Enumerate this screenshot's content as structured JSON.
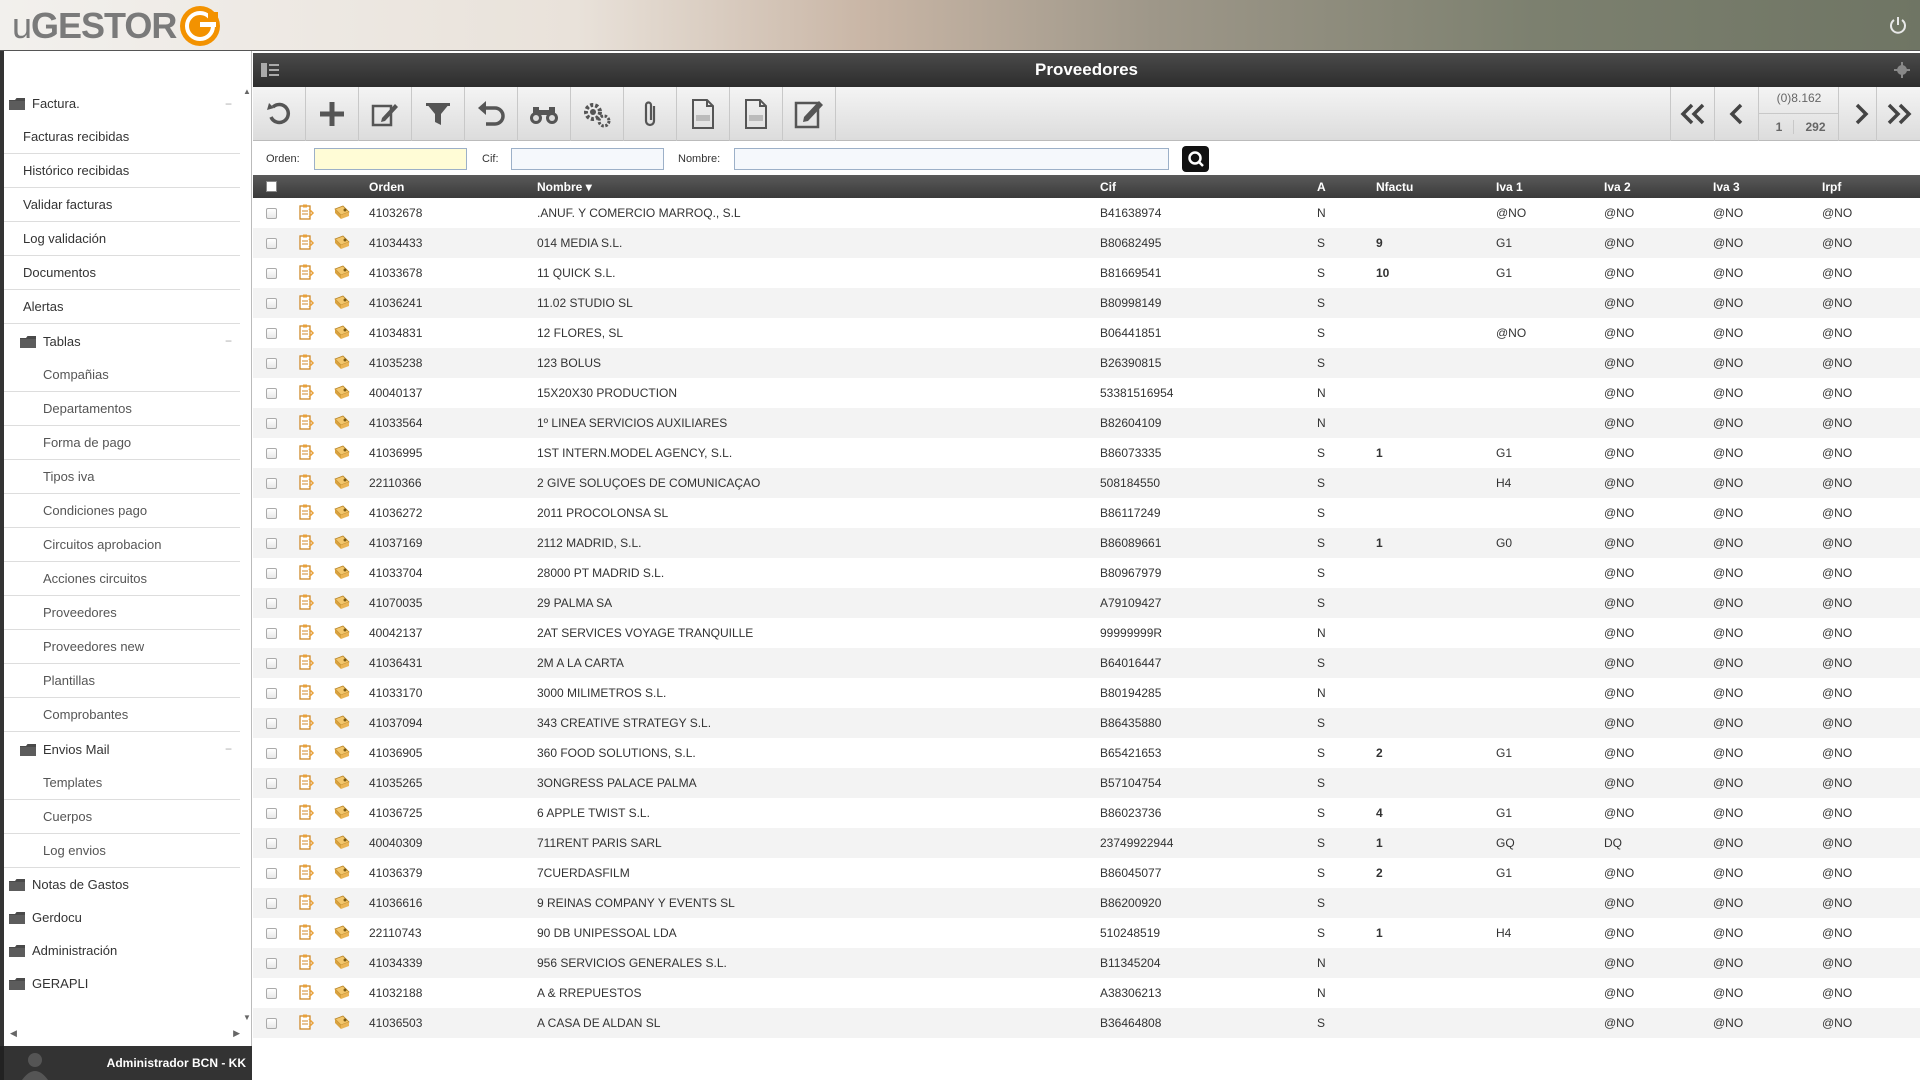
{
  "app": {
    "logo_prefix": "u",
    "logo_main": "GESTOR",
    "user_name": "Administrador BCN - KK"
  },
  "colors": {
    "accent": "#f39200",
    "header_dark": "#333333"
  },
  "sidebar": {
    "items": [
      {
        "label": "Factura.",
        "level": 0,
        "folder": true,
        "collapsible": true
      },
      {
        "label": "Facturas recibidas",
        "level": 1
      },
      {
        "label": "Histórico recibidas",
        "level": 1
      },
      {
        "label": "Validar facturas",
        "level": 1
      },
      {
        "label": "Log validación",
        "level": 1
      },
      {
        "label": "Documentos",
        "level": 1
      },
      {
        "label": "Alertas",
        "level": 1
      },
      {
        "label": "Tablas",
        "level": 1,
        "folder": true,
        "collapsible": true
      },
      {
        "label": "Compañias",
        "level": 2
      },
      {
        "label": "Departamentos",
        "level": 2
      },
      {
        "label": "Forma de pago",
        "level": 2
      },
      {
        "label": "Tipos iva",
        "level": 2
      },
      {
        "label": "Condiciones pago",
        "level": 2
      },
      {
        "label": "Circuitos aprobacion",
        "level": 2
      },
      {
        "label": "Acciones circuitos",
        "level": 2
      },
      {
        "label": "Proveedores",
        "level": 2
      },
      {
        "label": "Proveedores new",
        "level": 2
      },
      {
        "label": "Plantillas",
        "level": 2
      },
      {
        "label": "Comprobantes",
        "level": 2
      },
      {
        "label": "Envios Mail",
        "level": 1,
        "folder": true,
        "collapsible": true
      },
      {
        "label": "Templates",
        "level": 2
      },
      {
        "label": "Cuerpos",
        "level": 2
      },
      {
        "label": "Log envios",
        "level": 2
      },
      {
        "label": "Notas de Gastos",
        "level": 0,
        "folder": true
      },
      {
        "label": "Gerdocu",
        "level": 0,
        "folder": true
      },
      {
        "label": "Administración",
        "level": 0,
        "folder": true
      },
      {
        "label": "GERAPLI",
        "level": 0,
        "folder": true
      }
    ]
  },
  "page": {
    "title": "Proveedores"
  },
  "toolbar": {
    "buttons": [
      "refresh-icon",
      "add-icon",
      "edit-icon",
      "filter-icon",
      "undo-icon",
      "view-icon",
      "settings-icon",
      "attach-icon",
      "pdf-icon",
      "xls-icon",
      "notes-icon"
    ]
  },
  "pager": {
    "total": "(0)8.162",
    "current": "1",
    "pages": "292"
  },
  "filters": {
    "orden_label": "Orden:",
    "orden_value": "",
    "cif_label": "Cif:",
    "cif_value": "",
    "nombre_label": "Nombre:",
    "nombre_value": ""
  },
  "grid": {
    "columns": {
      "orden": "Orden",
      "nombre": "Nombre",
      "cif": "Cif",
      "a": "A",
      "nfactu": "Nfactu",
      "iva1": "Iva 1",
      "iva2": "Iva 2",
      "iva3": "Iva 3",
      "irpf": "Irpf"
    },
    "sort_indicator": "▾",
    "rows": [
      {
        "orden": "41032678",
        "nombre": ".ANUF. Y COMERCIO MARROQ., S.L",
        "cif": "B41638974",
        "a": "N",
        "nfactu": "",
        "iva1": "@NO",
        "iva2": "@NO",
        "iva3": "@NO",
        "irpf": "@NO"
      },
      {
        "orden": "41034433",
        "nombre": "014 MEDIA S.L.",
        "cif": "B80682495",
        "a": "S",
        "nfactu": "9",
        "iva1": "G1",
        "iva2": "@NO",
        "iva3": "@NO",
        "irpf": "@NO"
      },
      {
        "orden": "41033678",
        "nombre": "11 QUICK S.L.",
        "cif": "B81669541",
        "a": "S",
        "nfactu": "10",
        "iva1": "G1",
        "iva2": "@NO",
        "iva3": "@NO",
        "irpf": "@NO"
      },
      {
        "orden": "41036241",
        "nombre": "11.02 STUDIO SL",
        "cif": "B80998149",
        "a": "S",
        "nfactu": "",
        "iva1": "",
        "iva2": "@NO",
        "iva3": "@NO",
        "irpf": "@NO"
      },
      {
        "orden": "41034831",
        "nombre": "12 FLORES, SL",
        "cif": "B06441851",
        "a": "S",
        "nfactu": "",
        "iva1": "@NO",
        "iva2": "@NO",
        "iva3": "@NO",
        "irpf": "@NO"
      },
      {
        "orden": "41035238",
        "nombre": "123 BOLUS",
        "cif": "B26390815",
        "a": "S",
        "nfactu": "",
        "iva1": "",
        "iva2": "@NO",
        "iva3": "@NO",
        "irpf": "@NO"
      },
      {
        "orden": "40040137",
        "nombre": "15X20X30 PRODUCTION",
        "cif": "53381516954",
        "a": "N",
        "nfactu": "",
        "iva1": "",
        "iva2": "@NO",
        "iva3": "@NO",
        "irpf": "@NO"
      },
      {
        "orden": "41033564",
        "nombre": "1º LINEA SERVICIOS AUXILIARES",
        "cif": "B82604109",
        "a": "N",
        "nfactu": "",
        "iva1": "",
        "iva2": "@NO",
        "iva3": "@NO",
        "irpf": "@NO"
      },
      {
        "orden": "41036995",
        "nombre": "1ST INTERN.MODEL AGENCY, S.L.",
        "cif": "B86073335",
        "a": "S",
        "nfactu": "1",
        "iva1": "G1",
        "iva2": "@NO",
        "iva3": "@NO",
        "irpf": "@NO"
      },
      {
        "orden": "22110366",
        "nombre": "2 GIVE SOLUÇOES DE COMUNICAÇAO",
        "cif": "508184550",
        "a": "S",
        "nfactu": "",
        "iva1": "H4",
        "iva2": "@NO",
        "iva3": "@NO",
        "irpf": "@NO"
      },
      {
        "orden": "41036272",
        "nombre": "2011 PROCOLONSA SL",
        "cif": "B86117249",
        "a": "S",
        "nfactu": "",
        "iva1": "",
        "iva2": "@NO",
        "iva3": "@NO",
        "irpf": "@NO"
      },
      {
        "orden": "41037169",
        "nombre": "2112 MADRID, S.L.",
        "cif": "B86089661",
        "a": "S",
        "nfactu": "1",
        "iva1": "G0",
        "iva2": "@NO",
        "iva3": "@NO",
        "irpf": "@NO"
      },
      {
        "orden": "41033704",
        "nombre": "28000 PT MADRID S.L.",
        "cif": "B80967979",
        "a": "S",
        "nfactu": "",
        "iva1": "",
        "iva2": "@NO",
        "iva3": "@NO",
        "irpf": "@NO"
      },
      {
        "orden": "41070035",
        "nombre": "29 PALMA SA",
        "cif": "A79109427",
        "a": "S",
        "nfactu": "",
        "iva1": "",
        "iva2": "@NO",
        "iva3": "@NO",
        "irpf": "@NO"
      },
      {
        "orden": "40042137",
        "nombre": "2AT SERVICES VOYAGE TRANQUILLE",
        "cif": "99999999R",
        "a": "N",
        "nfactu": "",
        "iva1": "",
        "iva2": "@NO",
        "iva3": "@NO",
        "irpf": "@NO"
      },
      {
        "orden": "41036431",
        "nombre": "2M A LA CARTA",
        "cif": "B64016447",
        "a": "S",
        "nfactu": "",
        "iva1": "",
        "iva2": "@NO",
        "iva3": "@NO",
        "irpf": "@NO"
      },
      {
        "orden": "41033170",
        "nombre": "3000 MILIMETROS S.L.",
        "cif": "B80194285",
        "a": "N",
        "nfactu": "",
        "iva1": "",
        "iva2": "@NO",
        "iva3": "@NO",
        "irpf": "@NO"
      },
      {
        "orden": "41037094",
        "nombre": "343 CREATIVE STRATEGY S.L.",
        "cif": "B86435880",
        "a": "S",
        "nfactu": "",
        "iva1": "",
        "iva2": "@NO",
        "iva3": "@NO",
        "irpf": "@NO"
      },
      {
        "orden": "41036905",
        "nombre": "360 FOOD SOLUTIONS, S.L.",
        "cif": "B65421653",
        "a": "S",
        "nfactu": "2",
        "iva1": "G1",
        "iva2": "@NO",
        "iva3": "@NO",
        "irpf": "@NO"
      },
      {
        "orden": "41035265",
        "nombre": "3ONGRESS PALACE PALMA",
        "cif": "B57104754",
        "a": "S",
        "nfactu": "",
        "iva1": "",
        "iva2": "@NO",
        "iva3": "@NO",
        "irpf": "@NO"
      },
      {
        "orden": "41036725",
        "nombre": "6 APPLE TWIST S.L.",
        "cif": "B86023736",
        "a": "S",
        "nfactu": "4",
        "iva1": "G1",
        "iva2": "@NO",
        "iva3": "@NO",
        "irpf": "@NO"
      },
      {
        "orden": "40040309",
        "nombre": "711RENT PARIS SARL",
        "cif": "23749922944",
        "a": "S",
        "nfactu": "1",
        "iva1": "GQ",
        "iva2": "DQ",
        "iva3": "@NO",
        "irpf": "@NO"
      },
      {
        "orden": "41036379",
        "nombre": "7CUERDASFILM",
        "cif": "B86045077",
        "a": "S",
        "nfactu": "2",
        "iva1": "G1",
        "iva2": "@NO",
        "iva3": "@NO",
        "irpf": "@NO"
      },
      {
        "orden": "41036616",
        "nombre": "9 REINAS COMPANY Y EVENTS SL",
        "cif": "B86200920",
        "a": "S",
        "nfactu": "",
        "iva1": "",
        "iva2": "@NO",
        "iva3": "@NO",
        "irpf": "@NO"
      },
      {
        "orden": "22110743",
        "nombre": "90 DB UNIPESSOAL LDA",
        "cif": "510248519",
        "a": "S",
        "nfactu": "1",
        "iva1": "H4",
        "iva2": "@NO",
        "iva3": "@NO",
        "irpf": "@NO"
      },
      {
        "orden": "41034339",
        "nombre": "956 SERVICIOS GENERALES S.L.",
        "cif": "B11345204",
        "a": "N",
        "nfactu": "",
        "iva1": "",
        "iva2": "@NO",
        "iva3": "@NO",
        "irpf": "@NO"
      },
      {
        "orden": "41032188",
        "nombre": "A & RREPUESTOS",
        "cif": "A38306213",
        "a": "N",
        "nfactu": "",
        "iva1": "",
        "iva2": "@NO",
        "iva3": "@NO",
        "irpf": "@NO"
      },
      {
        "orden": "41036503",
        "nombre": "A CASA DE ALDAN SL",
        "cif": "B36464808",
        "a": "S",
        "nfactu": "",
        "iva1": "",
        "iva2": "@NO",
        "iva3": "@NO",
        "irpf": "@NO"
      }
    ]
  }
}
